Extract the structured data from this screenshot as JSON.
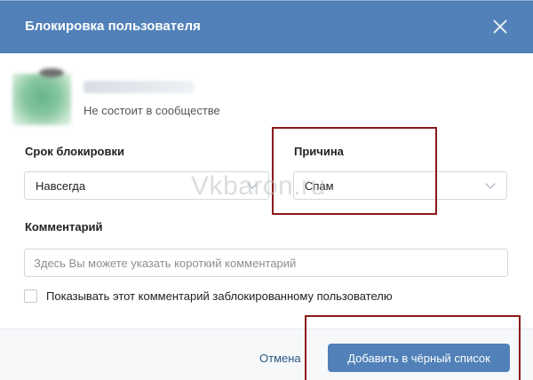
{
  "dialog": {
    "title": "Блокировка пользователя"
  },
  "user": {
    "status": "Не состоит в сообществе"
  },
  "block_duration": {
    "label": "Срок блокировки",
    "value": "Навсегда"
  },
  "reason": {
    "label": "Причина",
    "value": "Спам"
  },
  "comment": {
    "label": "Комментарий",
    "placeholder": "Здесь Вы можете указать короткий комментарий",
    "value": ""
  },
  "show_comment": {
    "label": "Показывать этот комментарий заблокированному пользователю",
    "checked": false
  },
  "footer": {
    "cancel_label": "Отмена",
    "submit_label": "Добавить в чёрный список"
  },
  "watermark": "Vkbaron.ru",
  "colors": {
    "header": "#5181b8",
    "primary_button": "#5181b8",
    "highlight_border": "#8b1a1a",
    "link": "#2a5885"
  },
  "icons": {
    "close": "close-icon",
    "dropdown": "chevron-down-icon"
  }
}
